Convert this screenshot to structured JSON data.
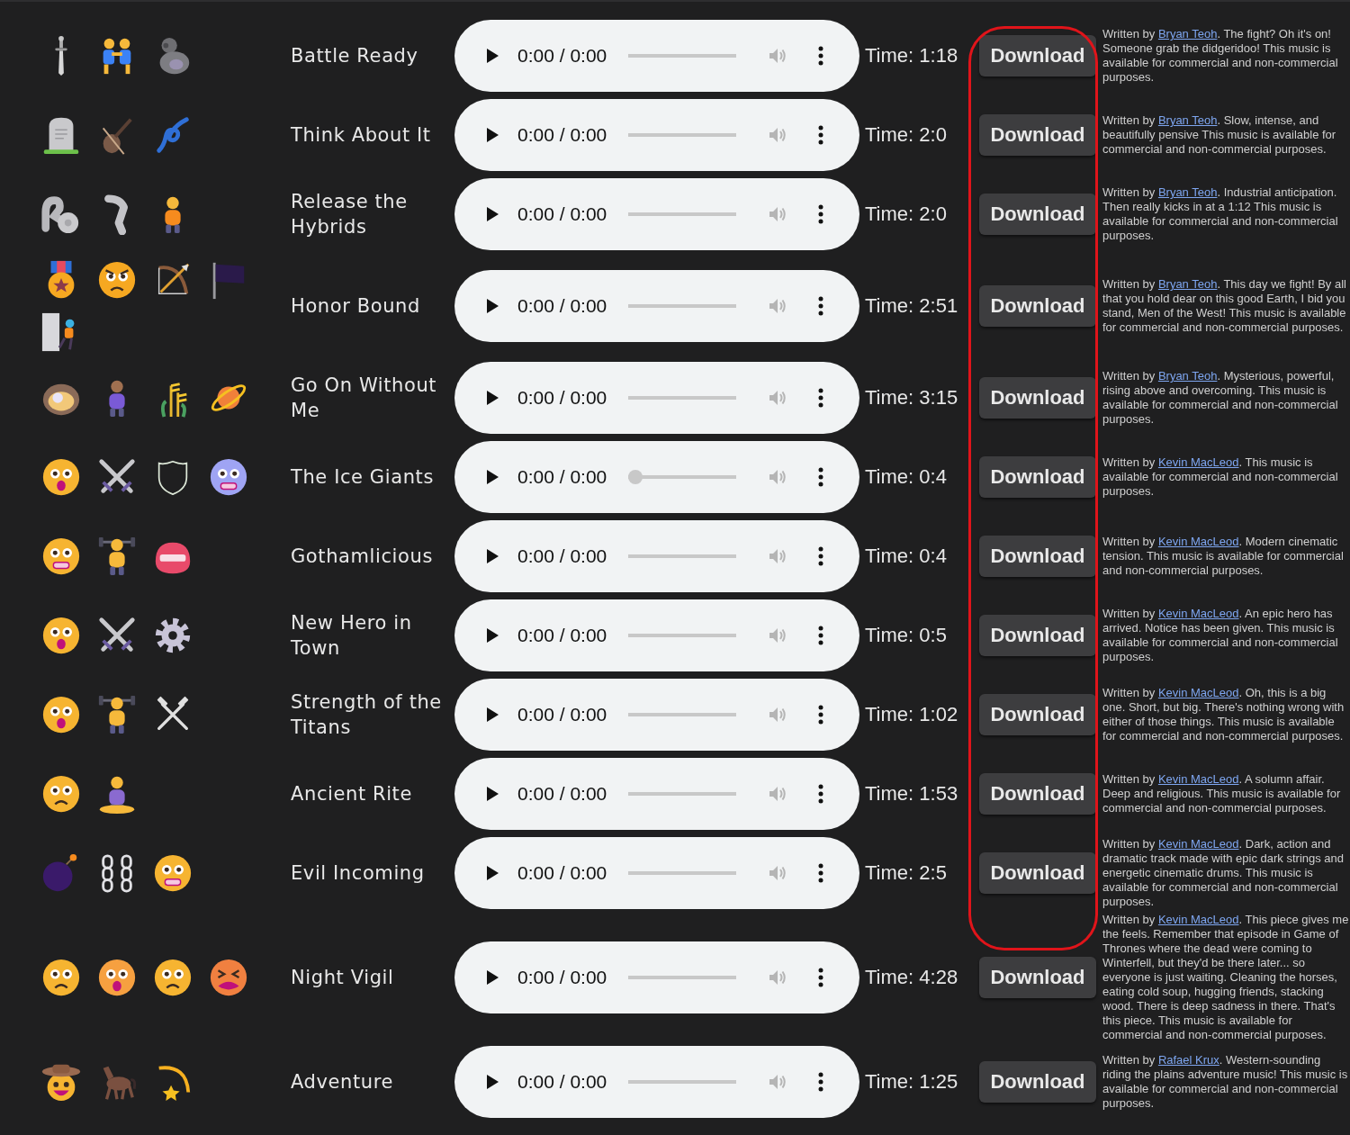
{
  "tracks": [
    {
      "title": "Battle Ready",
      "player": {
        "time": "0:00 / 0:00",
        "level": 0,
        "seek_thumb": false
      },
      "duration": "Time: 1:18",
      "button": "Download",
      "description": {
        "prefix": "Written by ",
        "author": "Bryan Teoh",
        "text": ". The fight? Oh it's on! Someone grab the didgeridoo! This music is available for commercial and non-commercial purposes."
      }
    },
    {
      "title": "Think About It",
      "player": {
        "time": "0:00 / 0:00",
        "level": 0,
        "seek_thumb": false
      },
      "duration": "Time: 2:0",
      "button": "Download",
      "description": {
        "prefix": "Written by ",
        "author": "Bryan Teoh",
        "text": ". Slow, intense, and beautifully pensive This music is available for commercial and non-commercial purposes."
      }
    },
    {
      "title": "Release the Hybrids",
      "player": {
        "time": "0:00 / 0:00",
        "level": 0,
        "seek_thumb": false
      },
      "duration": "Time: 2:0",
      "button": "Download",
      "description": {
        "prefix": "Written by ",
        "author": "Bryan Teoh",
        "text": ". Industrial anticipation. Then really kicks in at a 1:12 This music is available for commercial and non-commercial purposes."
      }
    },
    {
      "title": "Honor Bound",
      "player": {
        "time": "0:00 / 0:00",
        "level": 0,
        "seek_thumb": false
      },
      "duration": "Time: 2:51",
      "button": "Download",
      "description": {
        "prefix": "Written by ",
        "author": "Bryan Teoh",
        "text": ". This day we fight! By all that you hold dear on this good Earth, I bid you stand, Men of the West! This music is available for commercial and non-commercial purposes."
      }
    },
    {
      "title": "Go On Without Me",
      "player": {
        "time": "0:00 / 0:00",
        "level": 0,
        "seek_thumb": false
      },
      "duration": "Time: 3:15",
      "button": "Download",
      "description": {
        "prefix": "Written by ",
        "author": "Bryan Teoh",
        "text": ". Mysterious, powerful, rising above and overcoming. This music is available for commercial and non-commercial purposes."
      }
    },
    {
      "title": "The Ice Giants",
      "player": {
        "time": "0:00 / 0:00",
        "level": 0,
        "seek_thumb": true
      },
      "duration": "Time: 0:4",
      "button": "Download",
      "description": {
        "prefix": "Written by ",
        "author": "Kevin MacLeod",
        "text": ". This music is available for commercial and non-commercial purposes."
      }
    },
    {
      "title": "Gothamlicious",
      "player": {
        "time": "0:00 / 0:00",
        "level": 0,
        "seek_thumb": false
      },
      "duration": "Time: 0:4",
      "button": "Download",
      "description": {
        "prefix": "Written by ",
        "author": "Kevin MacLeod",
        "text": ". Modern cinematic tension. This music is available for commercial and non-commercial purposes."
      }
    },
    {
      "title": "New Hero in Town",
      "player": {
        "time": "0:00 / 0:00",
        "level": 0,
        "seek_thumb": false
      },
      "duration": "Time: 0:5",
      "button": "Download",
      "description": {
        "prefix": "Written by ",
        "author": "Kevin MacLeod",
        "text": ". An epic hero has arrived. Notice has been given. This music is available for commercial and non-commercial purposes."
      }
    },
    {
      "title": "Strength of the Titans",
      "player": {
        "time": "0:00 / 0:00",
        "level": 0,
        "seek_thumb": false
      },
      "duration": "Time: 1:02",
      "button": "Download",
      "description": {
        "prefix": "Written by ",
        "author": "Kevin MacLeod",
        "text": ". Oh, this is a big one. Short, but big. There's nothing wrong with either of those things. This music is available for commercial and non-commercial purposes."
      }
    },
    {
      "title": "Ancient Rite",
      "player": {
        "time": "0:00 / 0:00",
        "level": 0,
        "seek_thumb": false
      },
      "duration": "Time: 1:53",
      "button": "Download",
      "description": {
        "prefix": "Written by ",
        "author": "Kevin MacLeod",
        "text": ". A solumn affair. Deep and religious. This music is available for commercial and non-commercial purposes."
      }
    },
    {
      "title": "Evil Incoming",
      "player": {
        "time": "0:00 / 0:00",
        "level": 0,
        "seek_thumb": false
      },
      "duration": "Time: 2:5",
      "button": "Download",
      "description": {
        "prefix": "Written by ",
        "author": "Kevin MacLeod",
        "text": ". Dark, action and dramatic track made with epic dark strings and energetic cinematic drums. This music is available for commercial and non-commercial purposes."
      }
    },
    {
      "title": "Night Vigil",
      "player": {
        "time": "0:00 / 0:00",
        "level": 0,
        "seek_thumb": false
      },
      "duration": "Time: 4:28",
      "button": "Download",
      "description": {
        "prefix": "Written by ",
        "author": "Kevin MacLeod",
        "text": ". This piece gives me the feels. Remember that episode in Game of Thrones where the dead were coming to Winterfell, but they'd be there later... so everyone is just waiting. Cleaning the horses, eating cold soup, hugging friends, stacking wood. There is deep sadness in there. That's this piece. This music is available for commercial and non-commercial purposes."
      }
    },
    {
      "title": "Adventure",
      "player": {
        "time": "0:00 / 0:00",
        "level": 0,
        "seek_thumb": false
      },
      "duration": "Time: 1:25",
      "button": "Download",
      "description": {
        "prefix": "Written by ",
        "author": "Rafael Krux",
        "text": ". Western-sounding riding the plains adventure music! This music is available for commercial and non-commercial purposes."
      }
    }
  ]
}
